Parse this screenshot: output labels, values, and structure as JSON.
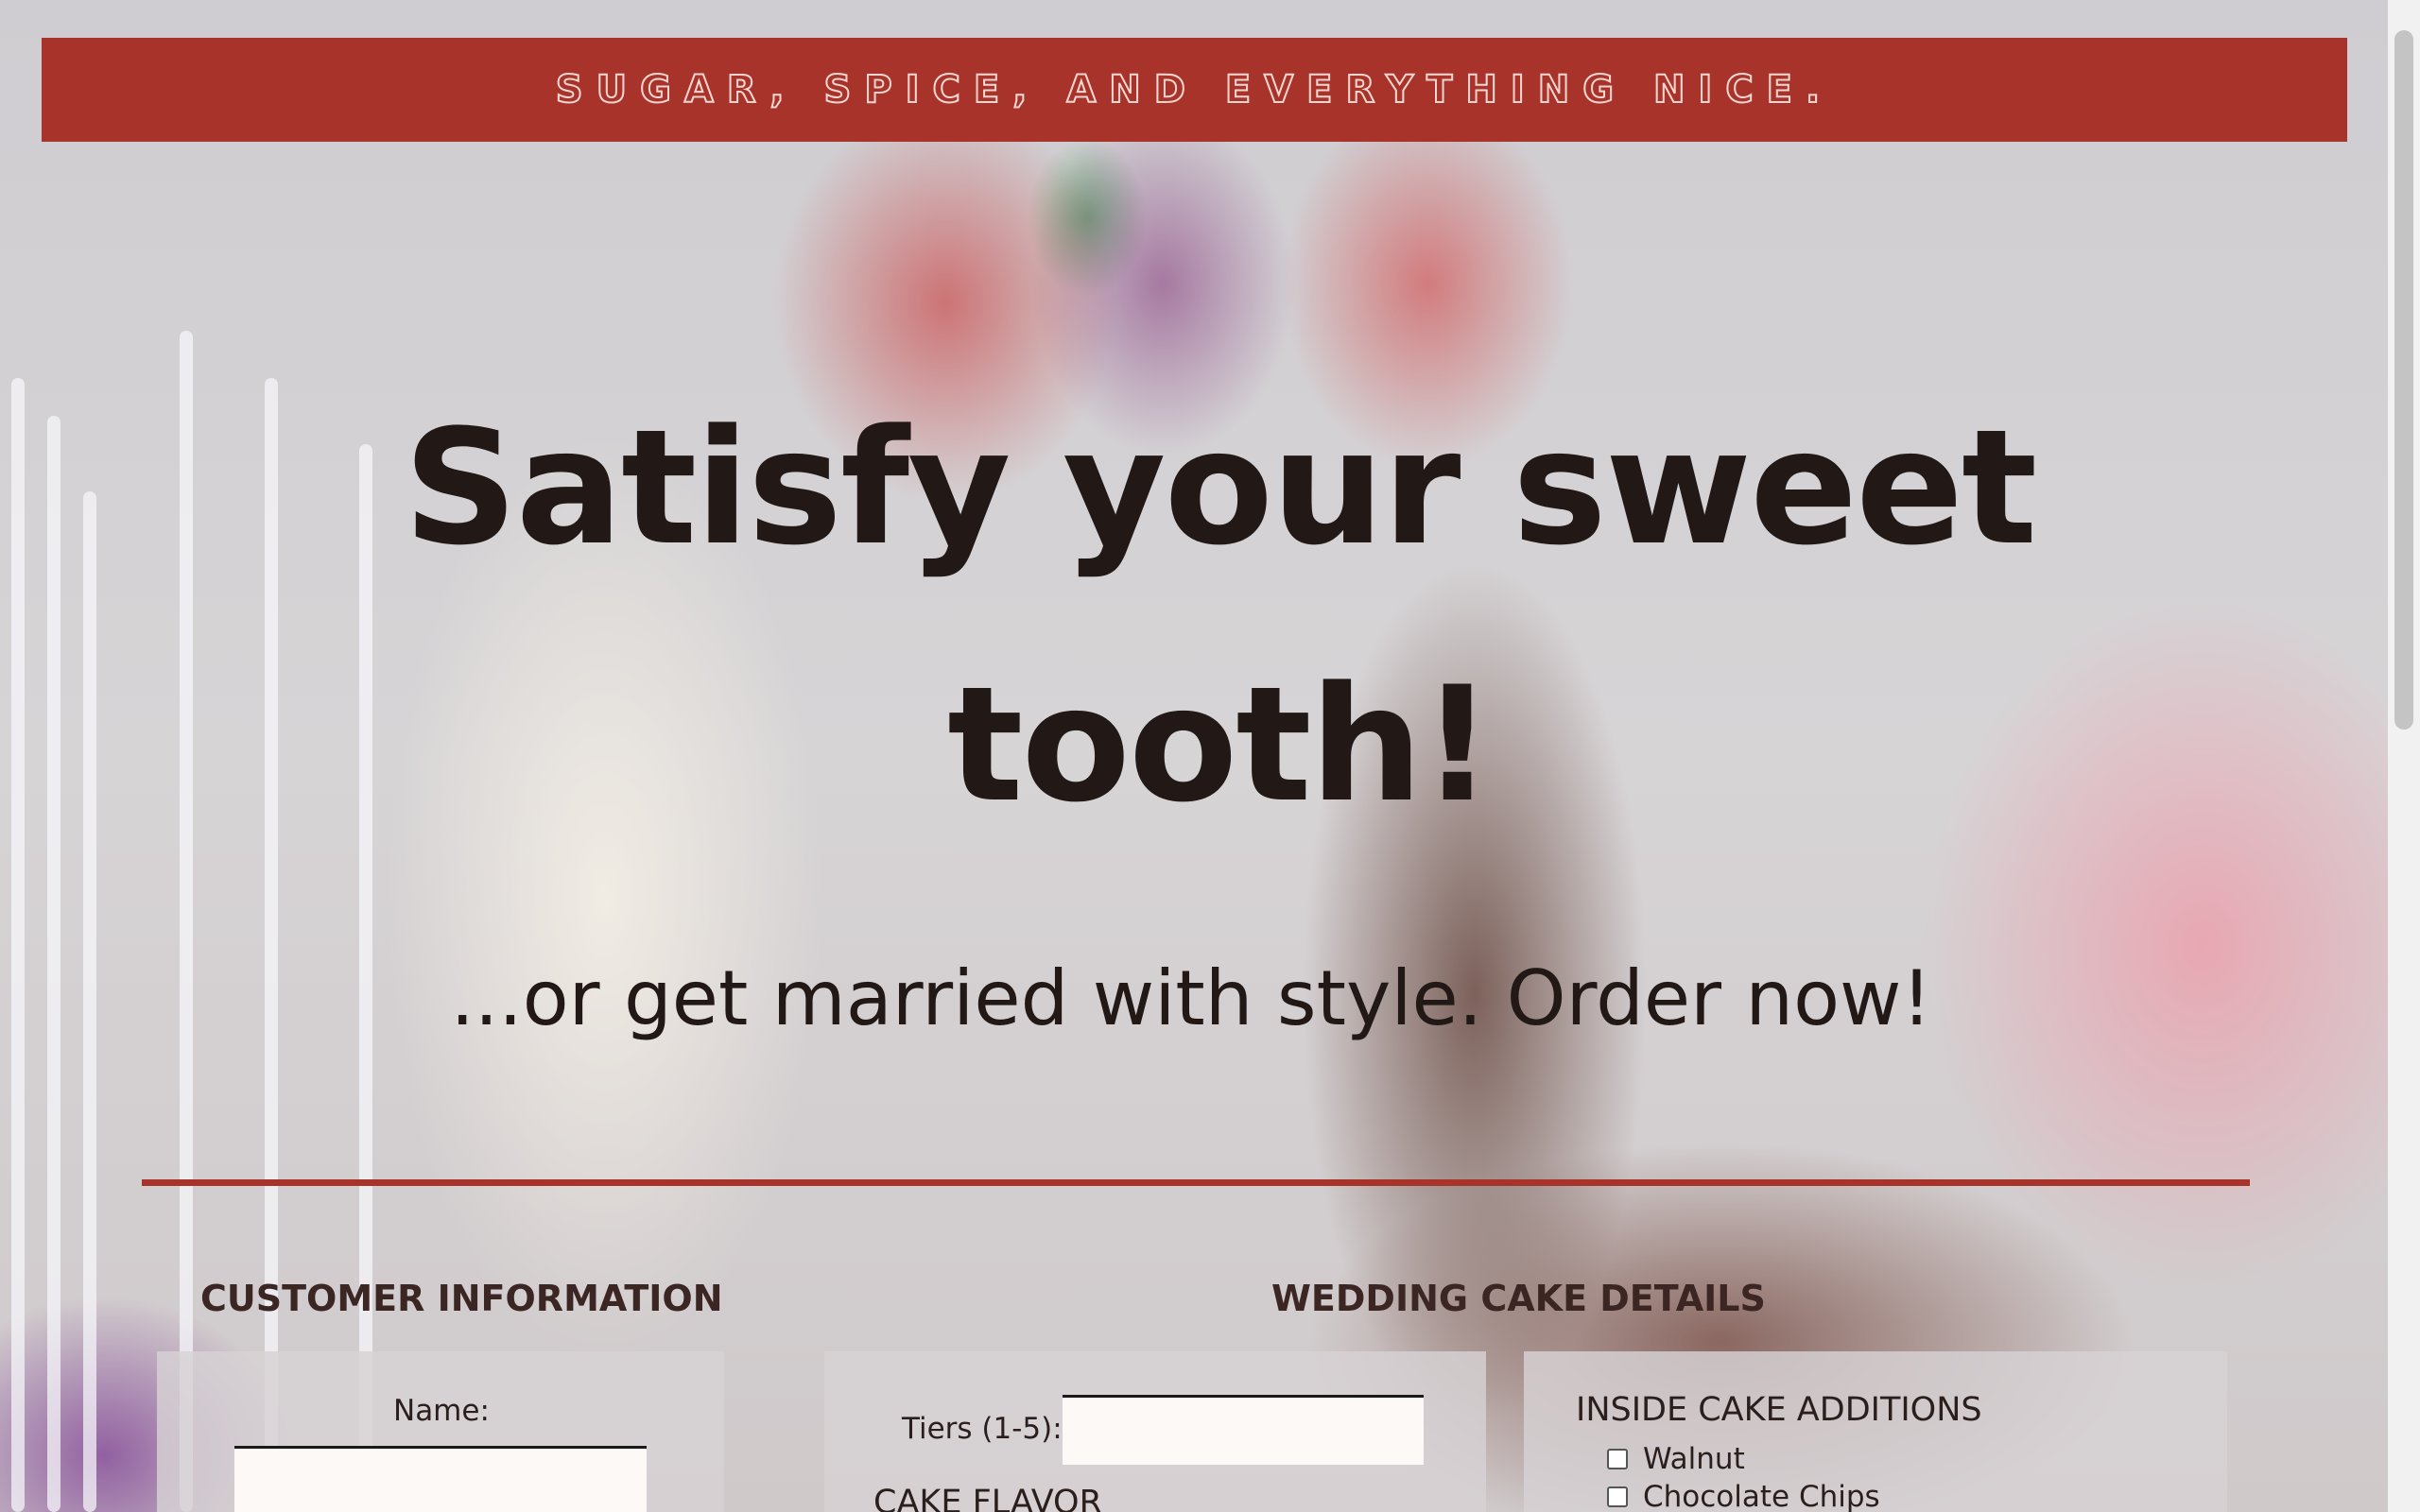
{
  "banner": {
    "text": "SUGAR, SPICE, AND EVERYTHING NICE."
  },
  "hero": {
    "headline": "Satisfy your sweet tooth!",
    "subheadline": "...or get married with style. Order now!"
  },
  "colors": {
    "accent": "#a8332a",
    "text_dark": "#221917",
    "banner_outline": "#f6d6d0",
    "input_bg": "#fdf9f7"
  },
  "customer_info": {
    "title": "CUSTOMER INFORMATION",
    "name_label": "Name:",
    "name_value": ""
  },
  "wedding_cake": {
    "title": "WEDDING CAKE DETAILS",
    "tiers_label": "Tiers (1-5):",
    "tiers_value": "",
    "flavor_title": "CAKE FLAVOR"
  },
  "additions": {
    "title": "INSIDE CAKE ADDITIONS",
    "items": [
      {
        "label": "Walnut",
        "checked": false
      },
      {
        "label": "Chocolate Chips",
        "checked": false
      }
    ]
  }
}
